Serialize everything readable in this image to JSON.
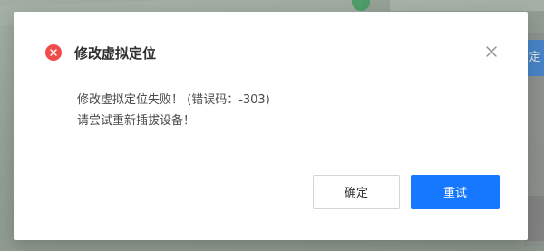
{
  "dialog": {
    "title": "修改虚拟定位",
    "message_line_1": "修改虚拟定位失败！ (错误码：-303)",
    "message_line_2": "请尝试重新插拔设备！",
    "confirm_label": "确定",
    "retry_label": "重试",
    "error_icon": "error-circle-icon",
    "close_icon": "close-icon"
  },
  "background": {
    "right_panel_text": "定位"
  },
  "colors": {
    "error_red": "#ef4b4b",
    "primary_blue": "#1677ff",
    "text_primary": "#2f2f2f",
    "text_secondary": "#4b4b4b"
  }
}
